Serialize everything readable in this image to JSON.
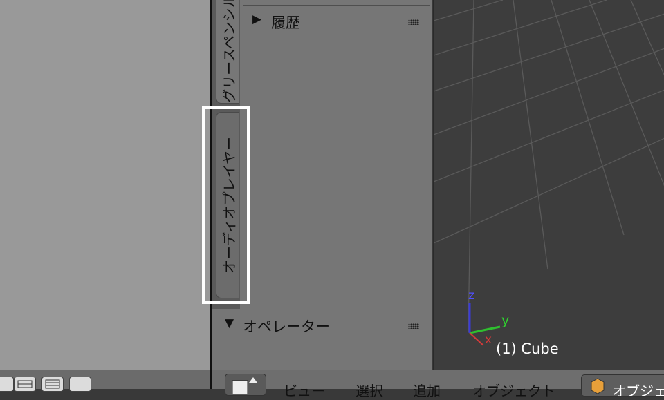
{
  "tabs": [
    {
      "label": "グリースペンシル"
    },
    {
      "label": "オーディオプレイヤー"
    }
  ],
  "history_panel": {
    "arrow": "▶",
    "title": "履歴"
  },
  "operator_panel": {
    "arrow": "▼",
    "title": "オペレーター"
  },
  "viewport": {
    "object_label": "(1) Cube",
    "axes": {
      "x": "x",
      "y": "y",
      "z": "z"
    }
  },
  "menu": {
    "view": "ビュー",
    "select": "選択",
    "add": "追加",
    "object": "オブジェクト",
    "mode": "オブジェクトモード"
  },
  "colors": {
    "axis_x": "#d43a3a",
    "axis_y": "#2fbf2f",
    "axis_z": "#3a3ad9",
    "highlight": "#ffffff"
  }
}
